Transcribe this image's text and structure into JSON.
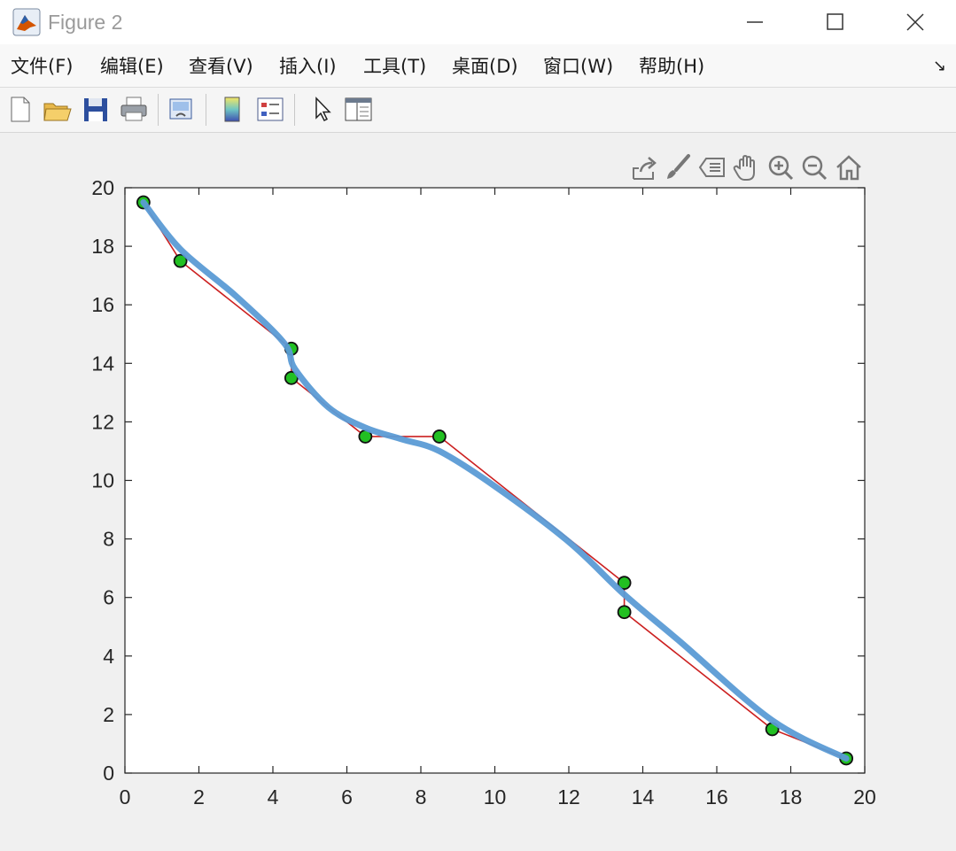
{
  "window": {
    "title": "Figure 2"
  },
  "menu": {
    "items": [
      {
        "label": "文件(F)"
      },
      {
        "label": "编辑(E)"
      },
      {
        "label": "查看(V)"
      },
      {
        "label": "插入(I)"
      },
      {
        "label": "工具(T)"
      },
      {
        "label": "桌面(D)"
      },
      {
        "label": "窗口(W)"
      },
      {
        "label": "帮助(H)"
      }
    ],
    "overflow_glyph": "↘"
  },
  "toolbar": {
    "buttons": [
      "new-figure",
      "open-file",
      "save",
      "print",
      "link-plot",
      "insert-colorbar",
      "insert-legend",
      "edit-plot",
      "property-inspector"
    ]
  },
  "axes_toolbar": {
    "buttons": [
      "export",
      "brush",
      "data-tips",
      "pan",
      "zoom-in",
      "zoom-out",
      "restore-view"
    ]
  },
  "colors": {
    "fit_line": "#5b9bd5",
    "polyline": "#cc2020",
    "marker_fill": "#22c022",
    "marker_edge": "#111111"
  },
  "chart_data": {
    "type": "line",
    "title": "",
    "xlabel": "",
    "ylabel": "",
    "xlim": [
      0,
      20
    ],
    "ylim": [
      0,
      20
    ],
    "xticks": [
      0,
      2,
      4,
      6,
      8,
      10,
      12,
      14,
      16,
      18,
      20
    ],
    "yticks": [
      0,
      2,
      4,
      6,
      8,
      10,
      12,
      14,
      16,
      18,
      20
    ],
    "grid": false,
    "legend": "none",
    "series": [
      {
        "style": "polyline-with-markers",
        "x": [
          0.5,
          1.5,
          4.5,
          4.5,
          6.5,
          8.5,
          13.5,
          13.5,
          17.5,
          19.5
        ],
        "y": [
          19.5,
          17.5,
          14.5,
          13.5,
          11.5,
          11.5,
          6.5,
          5.5,
          1.5,
          0.5
        ]
      },
      {
        "style": "smooth-fit-curve",
        "x": [
          0.5,
          1.5,
          3.0,
          4.3,
          4.6,
          5.5,
          6.5,
          7.5,
          8.5,
          10.0,
          12.0,
          13.5,
          15.0,
          17.5,
          19.5
        ],
        "y": [
          19.5,
          17.9,
          16.3,
          14.7,
          13.8,
          12.5,
          11.8,
          11.4,
          11.0,
          9.8,
          7.9,
          6.1,
          4.5,
          1.8,
          0.5
        ]
      }
    ]
  }
}
